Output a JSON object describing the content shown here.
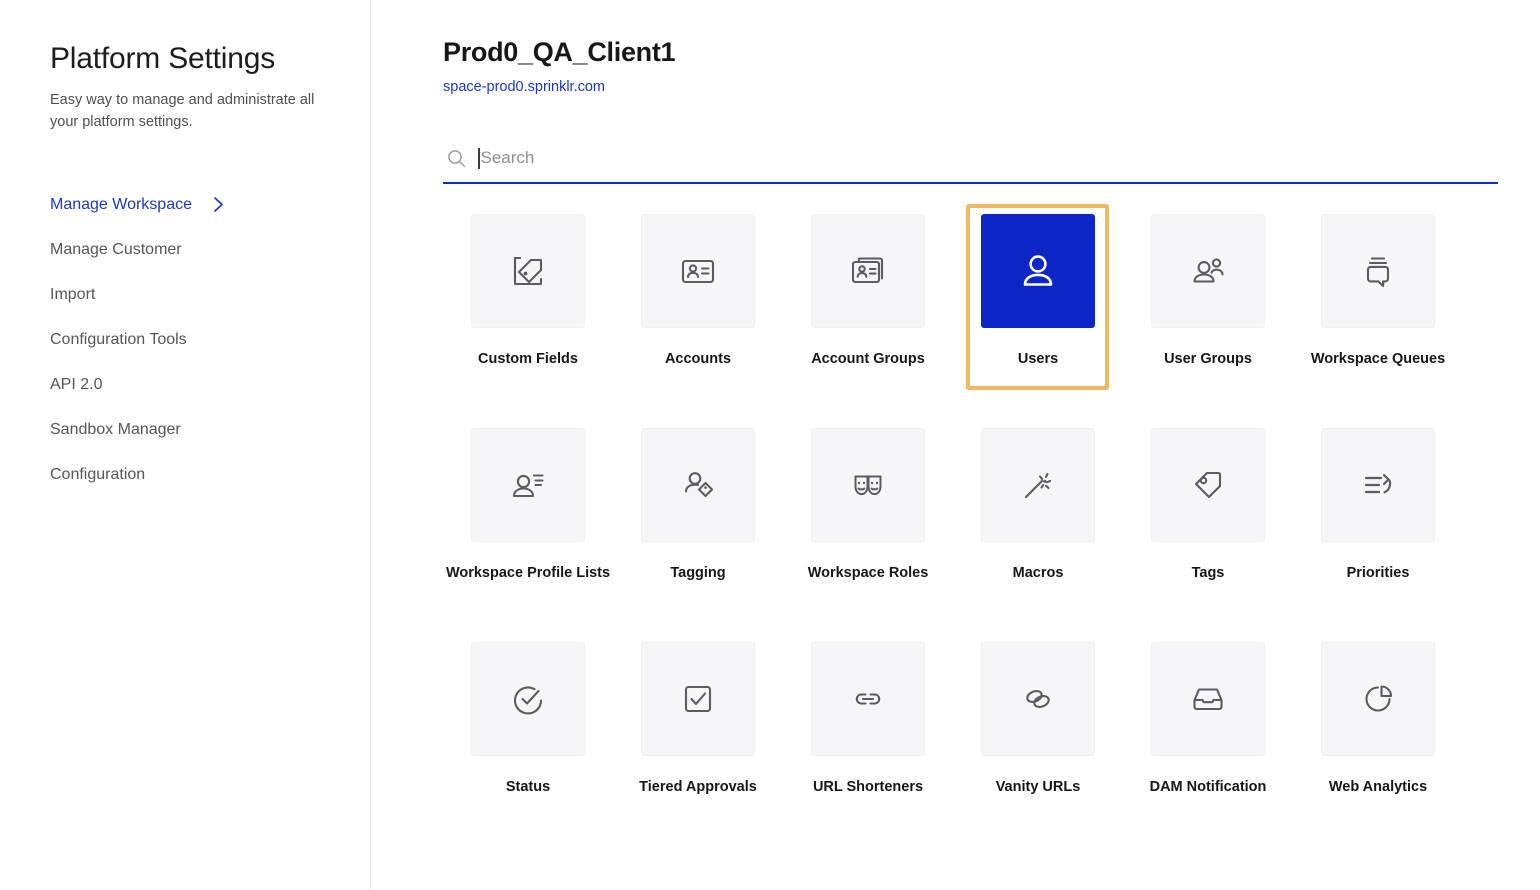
{
  "sidebar": {
    "title": "Platform Settings",
    "subtitle": "Easy way to manage and administrate all your platform settings.",
    "items": [
      {
        "label": "Manage Workspace",
        "active": true,
        "icon": "chevron-right-icon"
      },
      {
        "label": "Manage Customer",
        "active": false
      },
      {
        "label": "Import",
        "active": false
      },
      {
        "label": "Configuration Tools",
        "active": false
      },
      {
        "label": "API 2.0",
        "active": false
      },
      {
        "label": "Sandbox Manager",
        "active": false
      },
      {
        "label": "Configuration",
        "active": false
      }
    ]
  },
  "main": {
    "title": "Prod0_QA_Client1",
    "link": "space-prod0.sprinklr.com",
    "search": {
      "placeholder": "Search",
      "value": "",
      "icon": "search-icon",
      "focused": true
    },
    "tiles": [
      {
        "label": "Custom Fields",
        "icon": "custom-fields-icon",
        "selected": false
      },
      {
        "label": "Accounts",
        "icon": "id-card-icon",
        "selected": false
      },
      {
        "label": "Account Groups",
        "icon": "id-card-stack-icon",
        "selected": false
      },
      {
        "label": "Users",
        "icon": "user-icon",
        "selected": true
      },
      {
        "label": "User Groups",
        "icon": "users-group-icon",
        "selected": false
      },
      {
        "label": "Workspace Queues",
        "icon": "chat-stack-icon",
        "selected": false
      },
      {
        "label": "Workspace Profile Lists",
        "icon": "user-list-icon",
        "selected": false
      },
      {
        "label": "Tagging",
        "icon": "user-tag-icon",
        "selected": false
      },
      {
        "label": "Workspace Roles",
        "icon": "theatre-masks-icon",
        "selected": false
      },
      {
        "label": "Macros",
        "icon": "magic-wand-icon",
        "selected": false
      },
      {
        "label": "Tags",
        "icon": "tag-icon",
        "selected": false
      },
      {
        "label": "Priorities",
        "icon": "list-reorder-icon",
        "selected": false
      },
      {
        "label": "Status",
        "icon": "clock-check-icon",
        "selected": false
      },
      {
        "label": "Tiered Approvals",
        "icon": "checkbox-icon",
        "selected": false
      },
      {
        "label": "URL Shorteners",
        "icon": "link-icon",
        "selected": false
      },
      {
        "label": "Vanity URLs",
        "icon": "link-oval-icon",
        "selected": false
      },
      {
        "label": "DAM Notification",
        "icon": "inbox-icon",
        "selected": false
      },
      {
        "label": "Web Analytics",
        "icon": "pie-chart-icon",
        "selected": false
      }
    ]
  },
  "colors": {
    "accent_blue": "#1a37d4",
    "tile_selected_blue": "#0d26c7",
    "highlight_amber": "#f0b861",
    "tile_bg": "#f6f6f8",
    "text_primary": "#16171a",
    "text_muted": "#55565e"
  }
}
